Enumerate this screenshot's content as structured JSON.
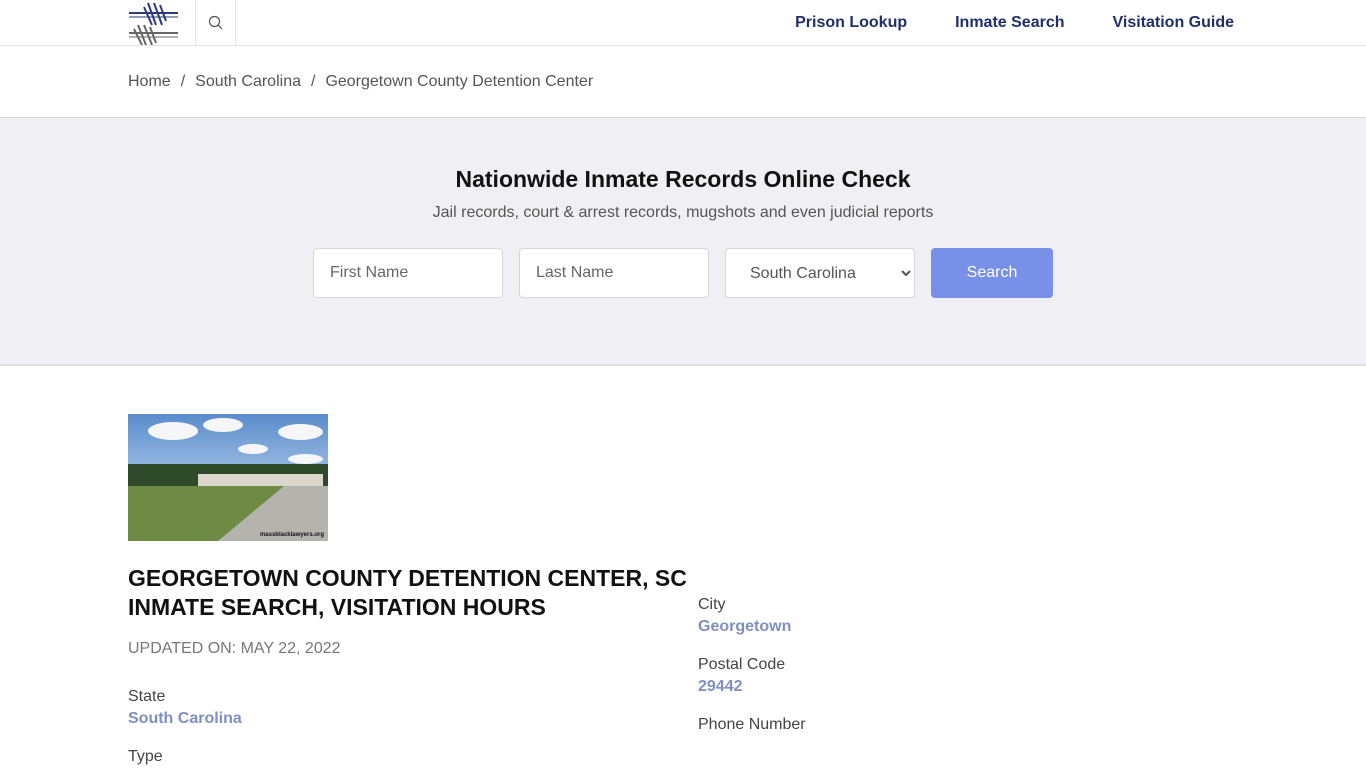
{
  "header": {
    "logo": "barbed-wire-logo",
    "search_icon": "search-icon",
    "nav": [
      "Prison Lookup",
      "Inmate Search",
      "Visitation Guide"
    ]
  },
  "breadcrumb": [
    "Home",
    "South Carolina",
    "Georgetown County Detention Center"
  ],
  "hero": {
    "title": "Nationwide Inmate Records Online Check",
    "subtitle": "Jail records, court & arrest records, mugshots and even judicial reports",
    "first_name_placeholder": "First Name",
    "last_name_placeholder": "Last Name",
    "state_selected": "South Carolina",
    "search_label": "Search",
    "accent_color": "#7890e8"
  },
  "facility": {
    "photo_credit": "massblacklawyers.org",
    "title_line1": "Georgetown County Detention Center, SC",
    "title_line2": "Inmate Search, Visitation Hours",
    "updated": "UPDATED ON: MAY 22, 2022",
    "fields_left": [
      {
        "label": "State",
        "value": "South Carolina"
      },
      {
        "label": "Type",
        "value": ""
      }
    ],
    "fields_right": [
      {
        "label": "City",
        "value": "Georgetown"
      },
      {
        "label": "Postal Code",
        "value": "29442"
      },
      {
        "label": "Phone Number",
        "value": ""
      }
    ]
  }
}
